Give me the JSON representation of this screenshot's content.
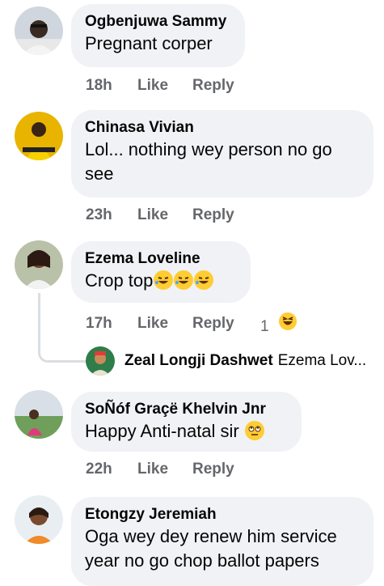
{
  "comments": [
    {
      "author": "Ogbenjuwa Sammy",
      "text": "Pregnant corper",
      "time": "18h",
      "like": "Like",
      "reply": "Reply"
    },
    {
      "author": "Chinasa Vivian",
      "text_line1": "Lol... nothing wey person no go",
      "text_line2": "see",
      "time": "23h",
      "like": "Like",
      "reply": "Reply"
    },
    {
      "author": "Ezema Loveline",
      "text": "Crop top",
      "time": "17h",
      "like": "Like",
      "reply": "Reply",
      "reaction_count": "1",
      "reaction_icon": "laughing-emoji-icon"
    },
    {
      "author": "SoÑóf Graçë Khelvin Jnr",
      "text": "Happy Anti-natal sir",
      "time": "22h",
      "like": "Like",
      "reply": "Reply"
    },
    {
      "author": "Etongzy Jeremiah",
      "text_line1": "Oga wey dey renew him service",
      "text_line2": "year no go chop ballot papers"
    }
  ],
  "thread_reply": {
    "author": "Zeal Longji Dashwet",
    "snippet": "Ezema Lov..."
  },
  "colors": {
    "bubble": "#f0f2f5",
    "meta": "#65676b",
    "text": "#050505",
    "emoji": "#ffcc33"
  }
}
